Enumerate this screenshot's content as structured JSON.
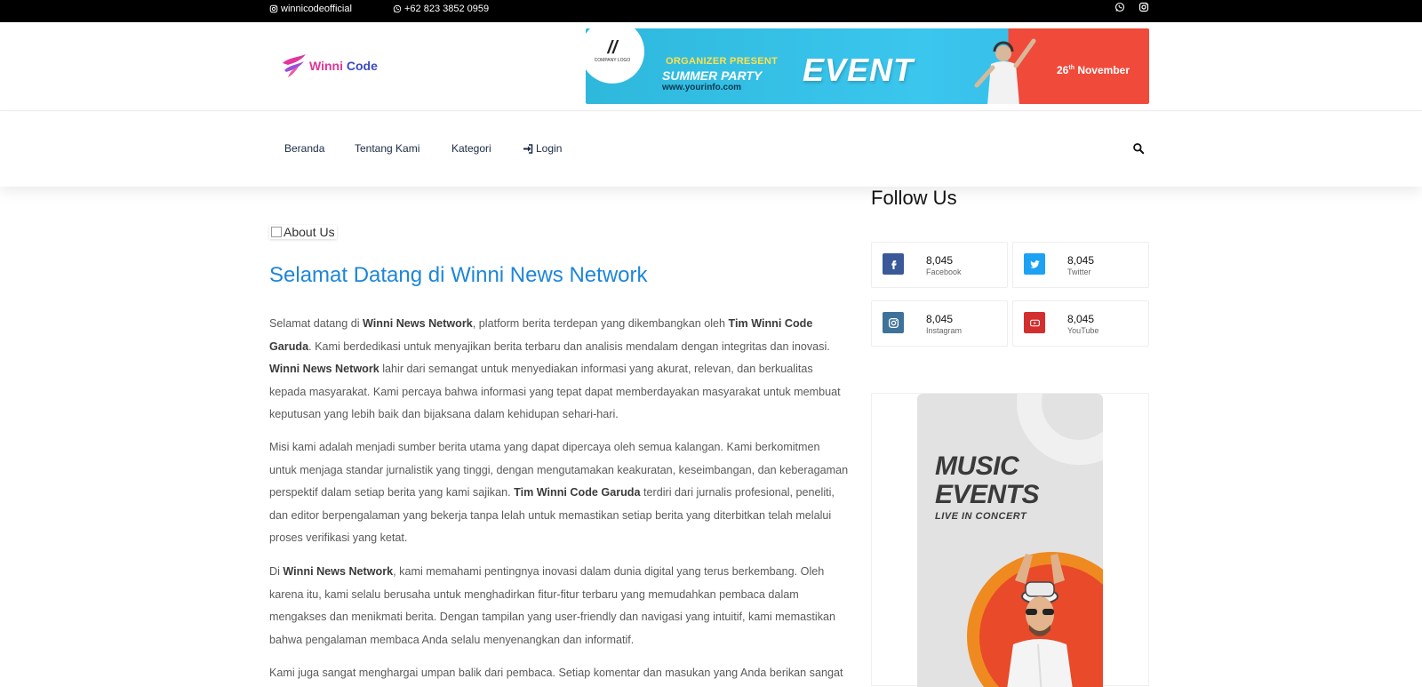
{
  "topbar": {
    "instagram_handle": "winnicodeofficial",
    "phone": "+62 823 3852 0959",
    "icons": [
      "instagram-icon",
      "whatsapp-icon",
      "whatsapp-icon",
      "instagram-icon"
    ]
  },
  "header": {
    "logo": {
      "part1": "Winni",
      "part2": "Code"
    },
    "banner": {
      "badge_label": "COMPANY LOGO",
      "organizer": "ORGANIZER PRESENT",
      "party": "SUMMER PARTY",
      "url": "www.yourinfo.com",
      "event": "EVENT",
      "date_day": "26",
      "date_suffix": "th",
      "date_month": "November"
    }
  },
  "nav": {
    "items": [
      "Beranda",
      "Tentang Kami",
      "Kategori",
      "Login"
    ]
  },
  "main": {
    "image_alt": "About Us",
    "title": "Selamat Datang di Winni News Network",
    "p1": {
      "a": "Selamat datang di ",
      "b1": "Winni News Network",
      "c": ", platform berita terdepan yang dikembangkan oleh ",
      "b2": "Tim Winni Code Garuda",
      "d": ". Kami berdedikasi untuk menyajikan berita terbaru dan analisis mendalam dengan integritas dan inovasi. ",
      "b3": "Winni News Network",
      "e": " lahir dari semangat untuk menyediakan informasi yang akurat, relevan, dan berkualitas kepada masyarakat. Kami percaya bahwa informasi yang tepat dapat memberdayakan masyarakat untuk membuat keputusan yang lebih baik dan bijaksana dalam kehidupan sehari-hari."
    },
    "p2": {
      "a": "Misi kami adalah menjadi sumber berita utama yang dapat dipercaya oleh semua kalangan. Kami berkomitmen untuk menjaga standar jurnalistik yang tinggi, dengan mengutamakan keakuratan, keseimbangan, dan keberagaman perspektif dalam setiap berita yang kami sajikan. ",
      "b1": "Tim Winni Code Garuda",
      "c": " terdiri dari jurnalis profesional, peneliti, dan editor berpengalaman yang bekerja tanpa lelah untuk memastikan setiap berita yang diterbitkan telah melalui proses verifikasi yang ketat."
    },
    "p3": {
      "a": "Di ",
      "b1": "Winni News Network",
      "c": ", kami memahami pentingnya inovasi dalam dunia digital yang terus berkembang. Oleh karena itu, kami selalu berusaha untuk menghadirkan fitur-fitur terbaru yang memudahkan pembaca dalam mengakses dan menikmati berita. Dengan tampilan yang user-friendly dan navigasi yang intuitif, kami memastikan bahwa pengalaman membaca Anda selalu menyenangkan dan informatif."
    },
    "p4": "Kami juga sangat menghargai umpan balik dari pembaca. Setiap komentar dan masukan yang Anda berikan sangat"
  },
  "sidebar": {
    "follow_title": "Follow Us",
    "socials": [
      {
        "count": "8,045",
        "network": "Facebook",
        "color": "#3b5998",
        "icon": "facebook-icon"
      },
      {
        "count": "8,045",
        "network": "Twitter",
        "color": "#1da1f2",
        "icon": "twitter-icon"
      },
      {
        "count": "8,045",
        "network": "Instagram",
        "color": "#3f729b",
        "icon": "instagram-icon"
      },
      {
        "count": "8,045",
        "network": "YouTube",
        "color": "#d32f2f",
        "icon": "youtube-icon"
      }
    ],
    "ad": {
      "line1": "MUSIC",
      "line2": "EVENTS",
      "line3": "LIVE IN CONCERT"
    }
  },
  "colors": {
    "title_blue": "#1e86d8",
    "topbar": "#000000",
    "nav_text": "#1b2a44"
  }
}
